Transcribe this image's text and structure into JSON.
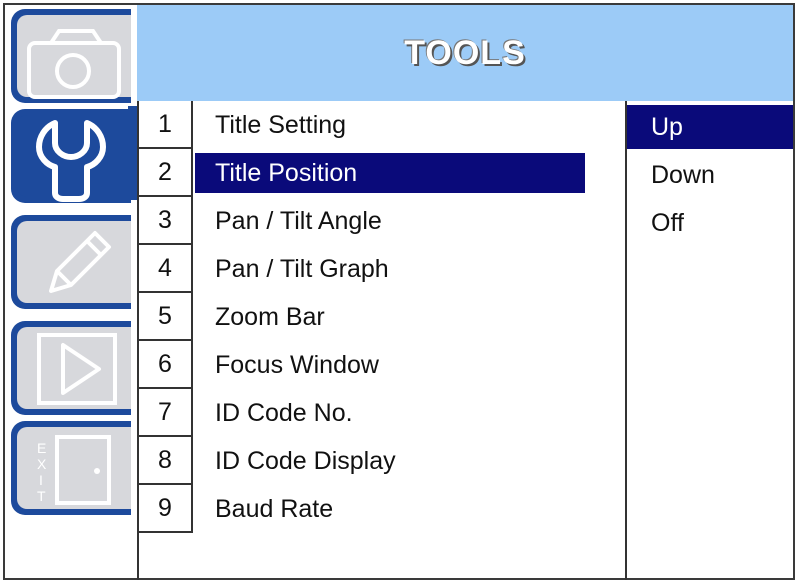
{
  "header": {
    "title": "TOOLS"
  },
  "sidebar": {
    "tabs": [
      {
        "name": "camera",
        "icon": "camera-icon",
        "active": false
      },
      {
        "name": "tools",
        "icon": "wrench-icon",
        "active": true
      },
      {
        "name": "edit",
        "icon": "pencil-icon",
        "active": false
      },
      {
        "name": "play",
        "icon": "play-icon",
        "active": false
      },
      {
        "name": "exit",
        "icon": "exit-icon",
        "active": false,
        "text": "EXIT"
      }
    ]
  },
  "menu": {
    "items": [
      {
        "num": "1",
        "label": "Title Setting"
      },
      {
        "num": "2",
        "label": "Title Position",
        "selected": true
      },
      {
        "num": "3",
        "label": "Pan / Tilt Angle"
      },
      {
        "num": "4",
        "label": "Pan / Tilt Graph"
      },
      {
        "num": "5",
        "label": "Zoom Bar"
      },
      {
        "num": "6",
        "label": "Focus Window"
      },
      {
        "num": "7",
        "label": "ID Code No."
      },
      {
        "num": "8",
        "label": "ID Code Display"
      },
      {
        "num": "9",
        "label": "Baud Rate"
      }
    ]
  },
  "options": {
    "items": [
      {
        "label": "Up",
        "selected": true
      },
      {
        "label": "Down"
      },
      {
        "label": "Off"
      }
    ]
  },
  "colors": {
    "header_bg": "#9ccbf7",
    "tab_blue": "#1d4a9c",
    "tab_gray": "#d7d8dc",
    "selection": "#0a0a7a"
  }
}
